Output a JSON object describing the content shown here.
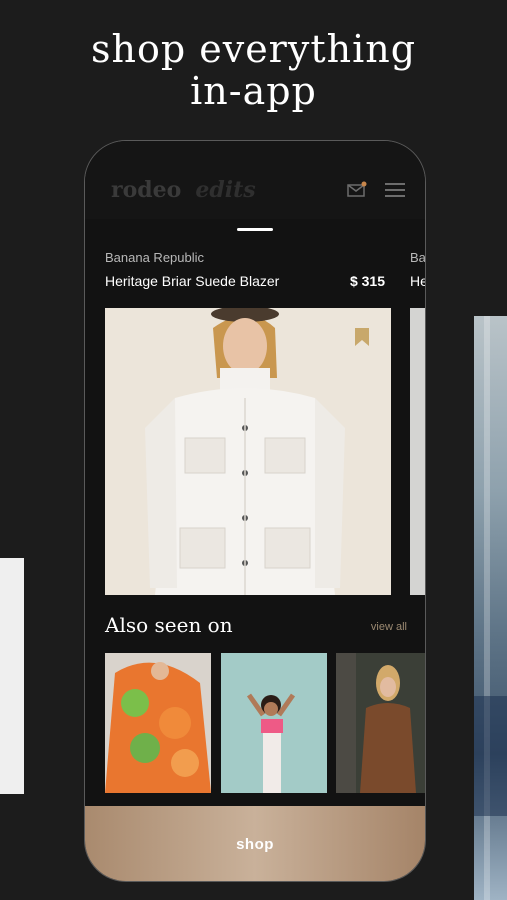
{
  "headline": {
    "line1": "shop everything",
    "line2": "in-app"
  },
  "app": {
    "logo_primary": "rodeo",
    "logo_secondary": "edits"
  },
  "icons": {
    "mail": "mail-notification-icon",
    "menu": "hamburger-menu-icon",
    "bookmark": "bookmark-icon"
  },
  "product": {
    "brand": "Banana Republic",
    "title": "Heritage Briar Suede Blazer",
    "price": "$ 315"
  },
  "next_product": {
    "brand": "Ba",
    "title": "He"
  },
  "also_seen": {
    "title": "Also seen on",
    "view_all": "view all"
  },
  "shop_button": {
    "label": "shop"
  },
  "colors": {
    "background": "#1c1c1c",
    "accent_gold": "#c9b19a",
    "bookmark": "#c8a86b",
    "notification_dot": "#c8864b"
  }
}
